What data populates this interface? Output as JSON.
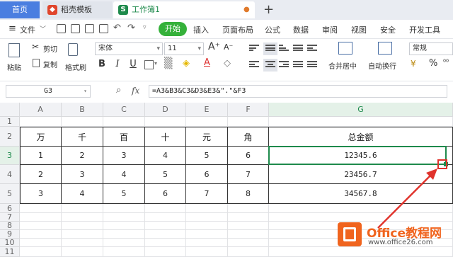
{
  "tabs": {
    "home": "首页",
    "template": "稻壳模板",
    "workbook": "工作簿1",
    "workbook_icon": "S",
    "add": "+"
  },
  "menu": {
    "file": "文件",
    "start": "开始",
    "items": [
      "插入",
      "页面布局",
      "公式",
      "数据",
      "审阅",
      "视图",
      "安全",
      "开发工具"
    ]
  },
  "ribbon": {
    "paste": "粘贴",
    "cut": "剪切",
    "copy": "复制",
    "format_painter": "格式刷",
    "font_name": "宋体",
    "font_size": "11",
    "bold": "B",
    "italic": "I",
    "underline": "U",
    "merge_center": "合并居中",
    "wrap_text": "自动换行",
    "number_format": "常规",
    "percent": "%"
  },
  "formula_bar": {
    "cell_ref": "G3",
    "fx": "fx",
    "formula": "=A3&B3&C3&D3&E3&\".\"&F3"
  },
  "columns": [
    "A",
    "B",
    "C",
    "D",
    "E",
    "F",
    "G"
  ],
  "rows": [
    "1",
    "2",
    "3",
    "4",
    "5",
    "6",
    "7",
    "8",
    "9",
    "10",
    "11"
  ],
  "table": {
    "headers": [
      "万",
      "千",
      "百",
      "十",
      "元",
      "角",
      "总金额"
    ],
    "data": [
      [
        "1",
        "2",
        "3",
        "4",
        "5",
        "6",
        "12345.6"
      ],
      [
        "2",
        "3",
        "4",
        "5",
        "6",
        "7",
        "23456.7"
      ],
      [
        "3",
        "4",
        "5",
        "6",
        "7",
        "8",
        "34567.8"
      ]
    ]
  },
  "watermark": {
    "brand": "Office教程网",
    "url": "www.office26.com"
  },
  "colors": {
    "accent_green": "#35b13a",
    "selection_green": "#1e8a4c",
    "annotation_red": "#e0332c",
    "brand_orange": "#f0641e"
  }
}
